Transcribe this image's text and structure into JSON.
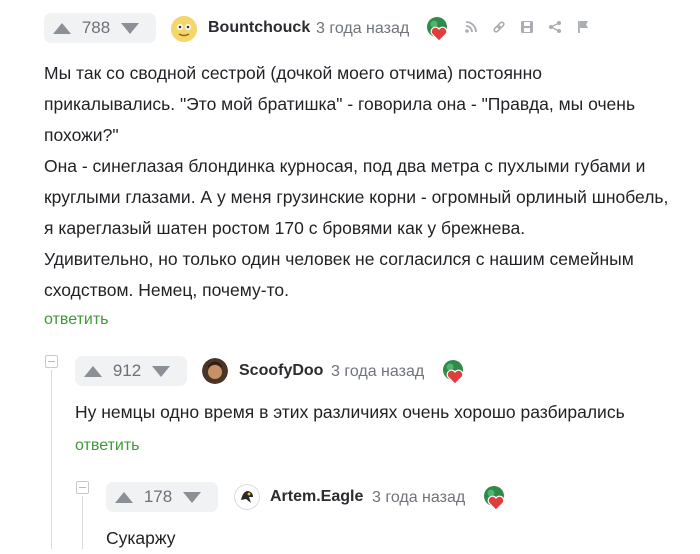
{
  "comments": [
    {
      "rating": "788",
      "author": "Bountchouck",
      "time": "3 года назад",
      "body": [
        "Мы так со сводной сестрой (дочкой моего отчима) постоянно",
        "прикалывались. \"Это мой братишка\" - говорила она - \"Правда, мы очень",
        "похожи?\"",
        "Она - синеглазая блондинка курносая, под два метра с пухлыми губами и",
        "круглыми глазами. А у меня грузинские корни - огромный орлиный шнобель,",
        "я кареглазый шатен ростом 170 с бровями как у брежнева.",
        "Удивительно, но только один человек не согласился с нашим семейным",
        "сходством. Немец, почему-то."
      ],
      "reply": "ответить"
    },
    {
      "rating": "912",
      "author": "ScoofyDoo",
      "time": "3 года назад",
      "body": [
        "Ну немцы одно время в этих различиях очень хорошо разбирались"
      ],
      "reply": "ответить"
    },
    {
      "rating": "178",
      "author": "Artem.Eagle",
      "time": "3 года назад",
      "body": [
        "Сукаржу"
      ]
    }
  ],
  "colors": {
    "accent_green": "#3e9a36",
    "vote_bg": "#f1f2f3",
    "muted": "#8b8f96"
  },
  "icons": [
    "vote-up-icon",
    "vote-down-icon",
    "award-heart-icon",
    "rss-icon",
    "link-icon",
    "save-icon",
    "share-icon",
    "flag-icon",
    "collapse-icon"
  ]
}
